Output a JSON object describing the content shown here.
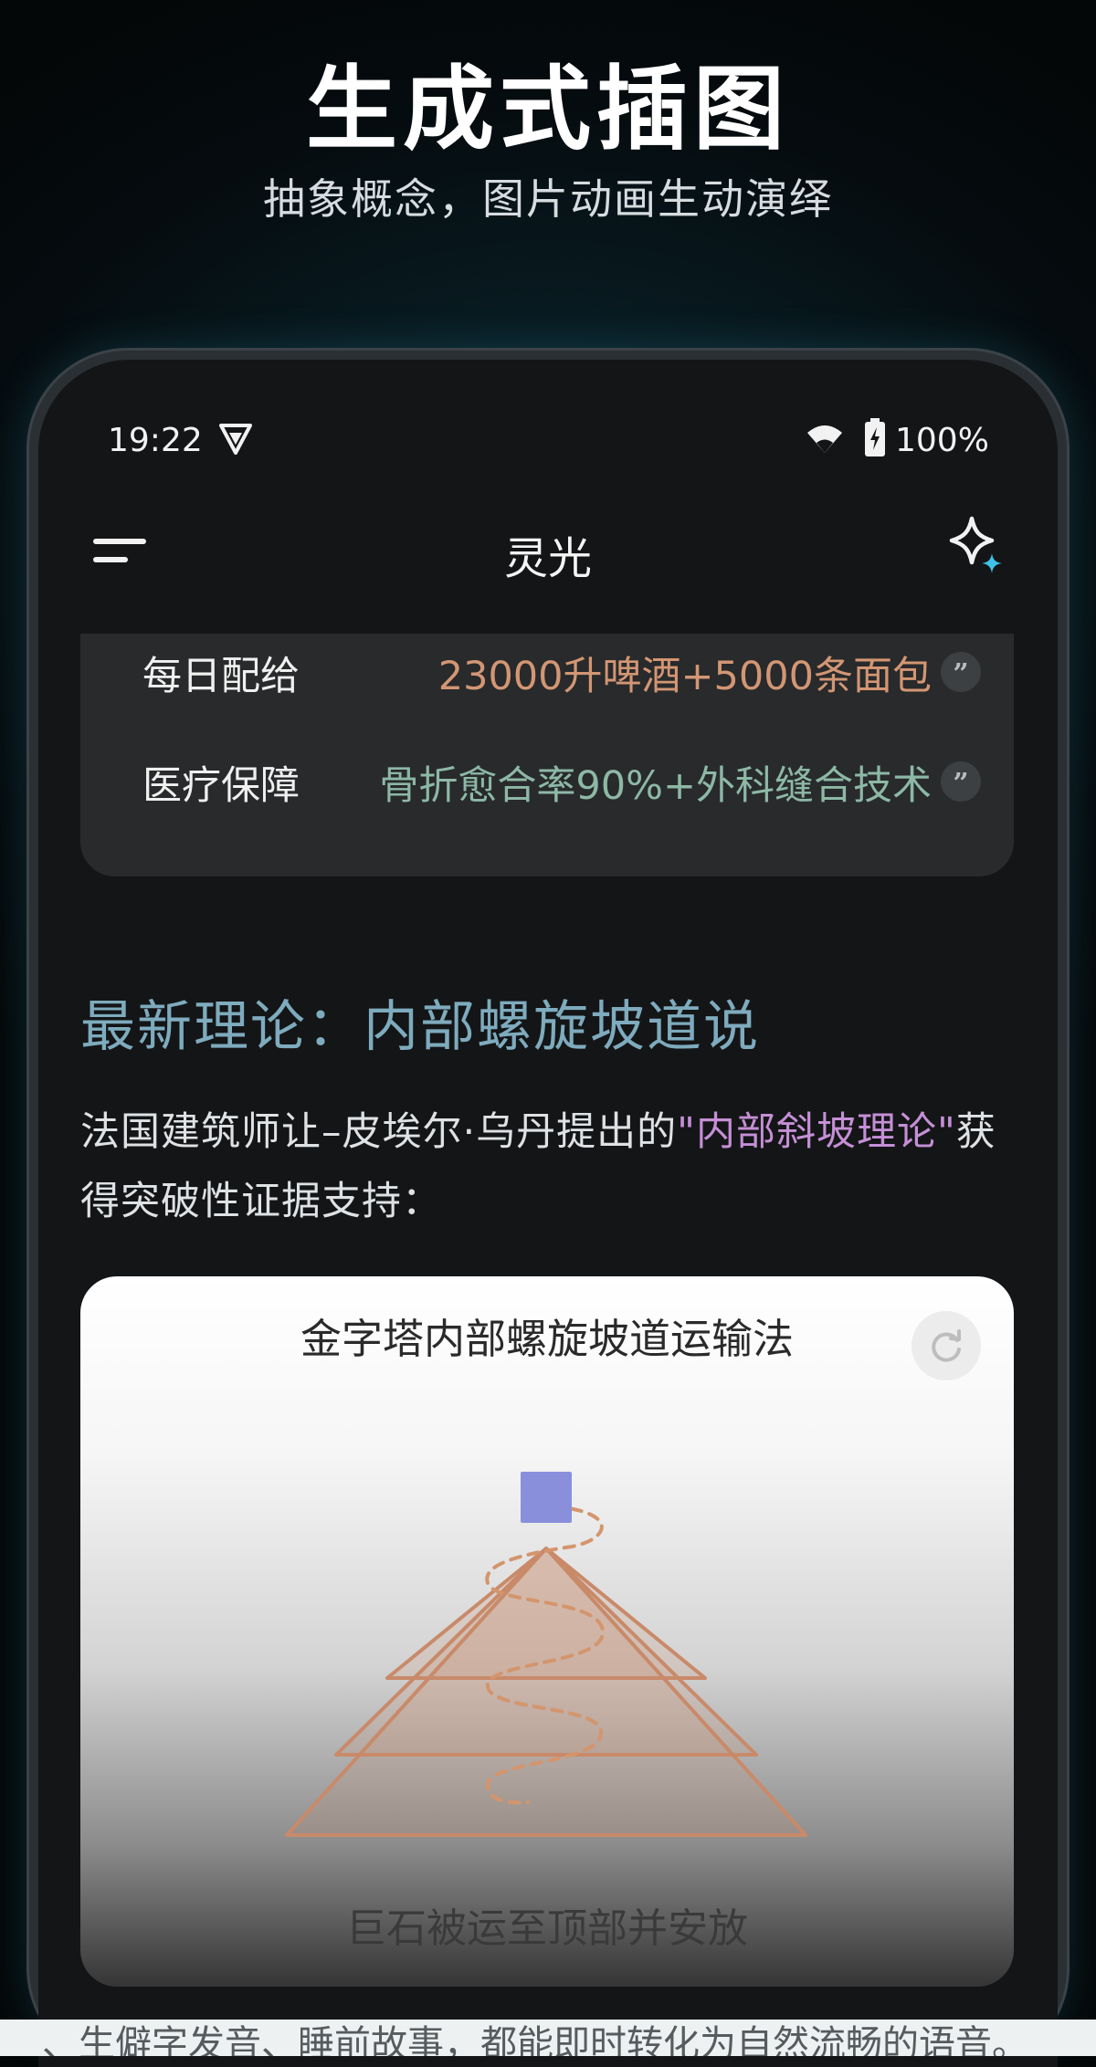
{
  "hero": {
    "title": "生成式插图",
    "subtitle": "抽象概念，图片动画生动演绎"
  },
  "status_bar": {
    "time": "19:22",
    "battery": "100%",
    "icons": [
      "vpn-shield-icon",
      "wifi-icon",
      "battery-charging-icon"
    ]
  },
  "app_bar": {
    "title": "灵光",
    "left_icon": "menu-icon",
    "right_icon": "sparkle-icon"
  },
  "info_rows": [
    {
      "label": "每日配给",
      "value": "23000升啤酒+5000条面包",
      "color": "#d39674"
    },
    {
      "label": "医疗保障",
      "value": "骨折愈合率90%+外科缝合技术",
      "color": "#8db8a6"
    }
  ],
  "section": {
    "heading": "最新理论：内部螺旋坡道说",
    "paragraph_before": "法国建筑师让–皮埃尔·乌丹提出的",
    "paragraph_highlight": "\"内部斜坡理论\"",
    "paragraph_after": "获得突破性证据支持："
  },
  "illustration": {
    "title": "金字塔内部螺旋坡道运输法",
    "caption": "巨石被运至顶部并安放",
    "refresh_icon": "refresh-icon",
    "colors": {
      "block": "#8a8fdc",
      "pyramid": "#c98a6a"
    }
  },
  "footer_partial_text": "、生僻字发音、睡前故事，都能即时转化为自然流畅的语音。",
  "colors": {
    "accent_heading": "#7eabbd",
    "highlight": "#c58fd6",
    "background": "#141517"
  }
}
